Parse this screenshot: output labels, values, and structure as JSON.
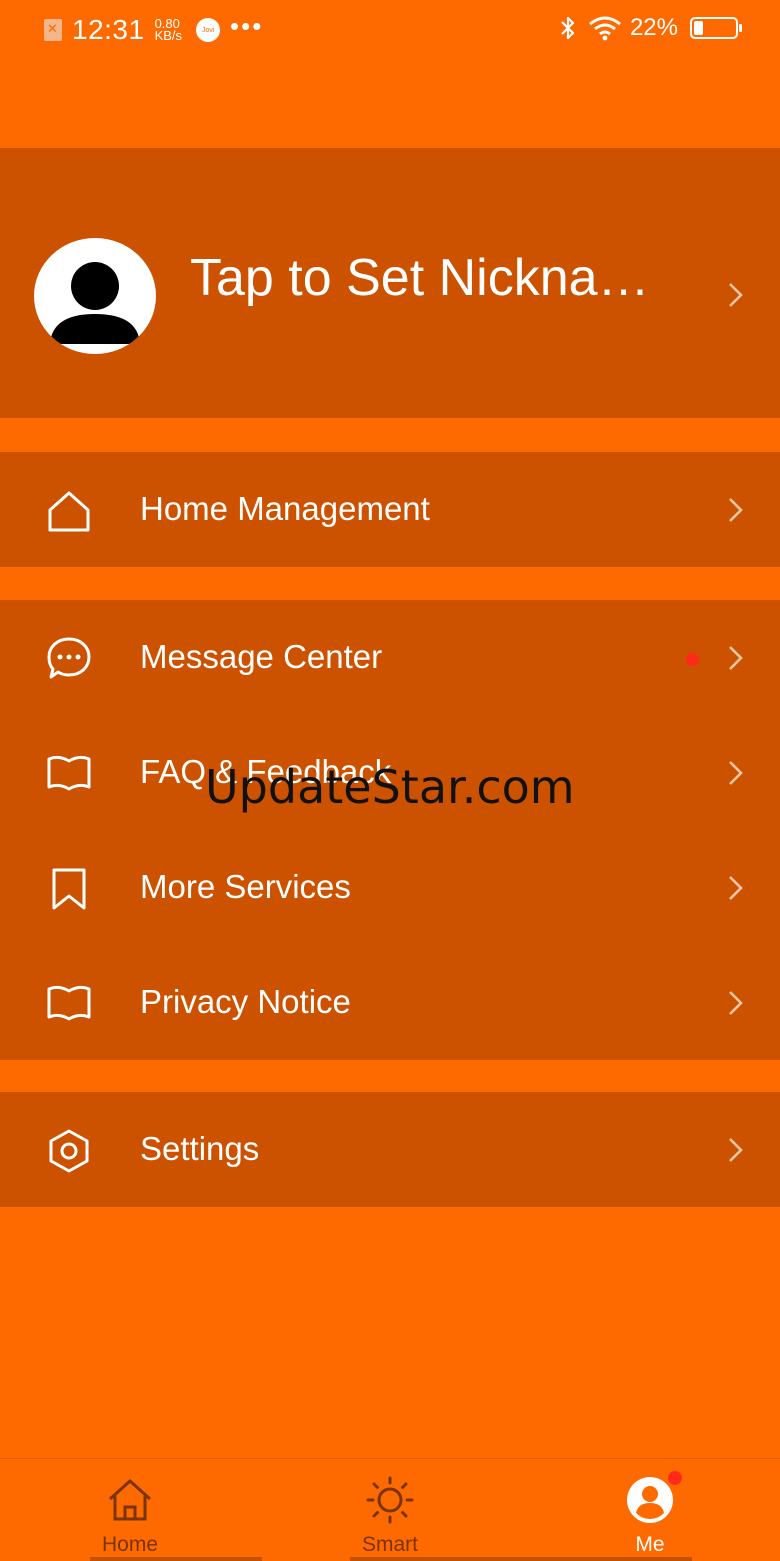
{
  "status_bar": {
    "time": "12:31",
    "speed_value": "0.80",
    "speed_unit": "KB/s",
    "jovi_label": "Jovi",
    "overflow": "•••",
    "battery_text": "22%",
    "battery_level": 0.22
  },
  "profile": {
    "nickname": "Tap to Set Nickna…"
  },
  "menu": {
    "home_management": "Home Management",
    "message_center": "Message Center",
    "faq_feedback": "FAQ & Feedback",
    "more_services": "More Services",
    "privacy_notice": "Privacy Notice",
    "settings": "Settings"
  },
  "watermark": "UpdateStar.com",
  "tabs": {
    "home": "Home",
    "smart": "Smart",
    "me": "Me"
  },
  "colors": {
    "background": "#FF6A00",
    "panel": "#CC5200",
    "badge": "#FF2A1A",
    "inactive_tab": "#7a3400"
  }
}
